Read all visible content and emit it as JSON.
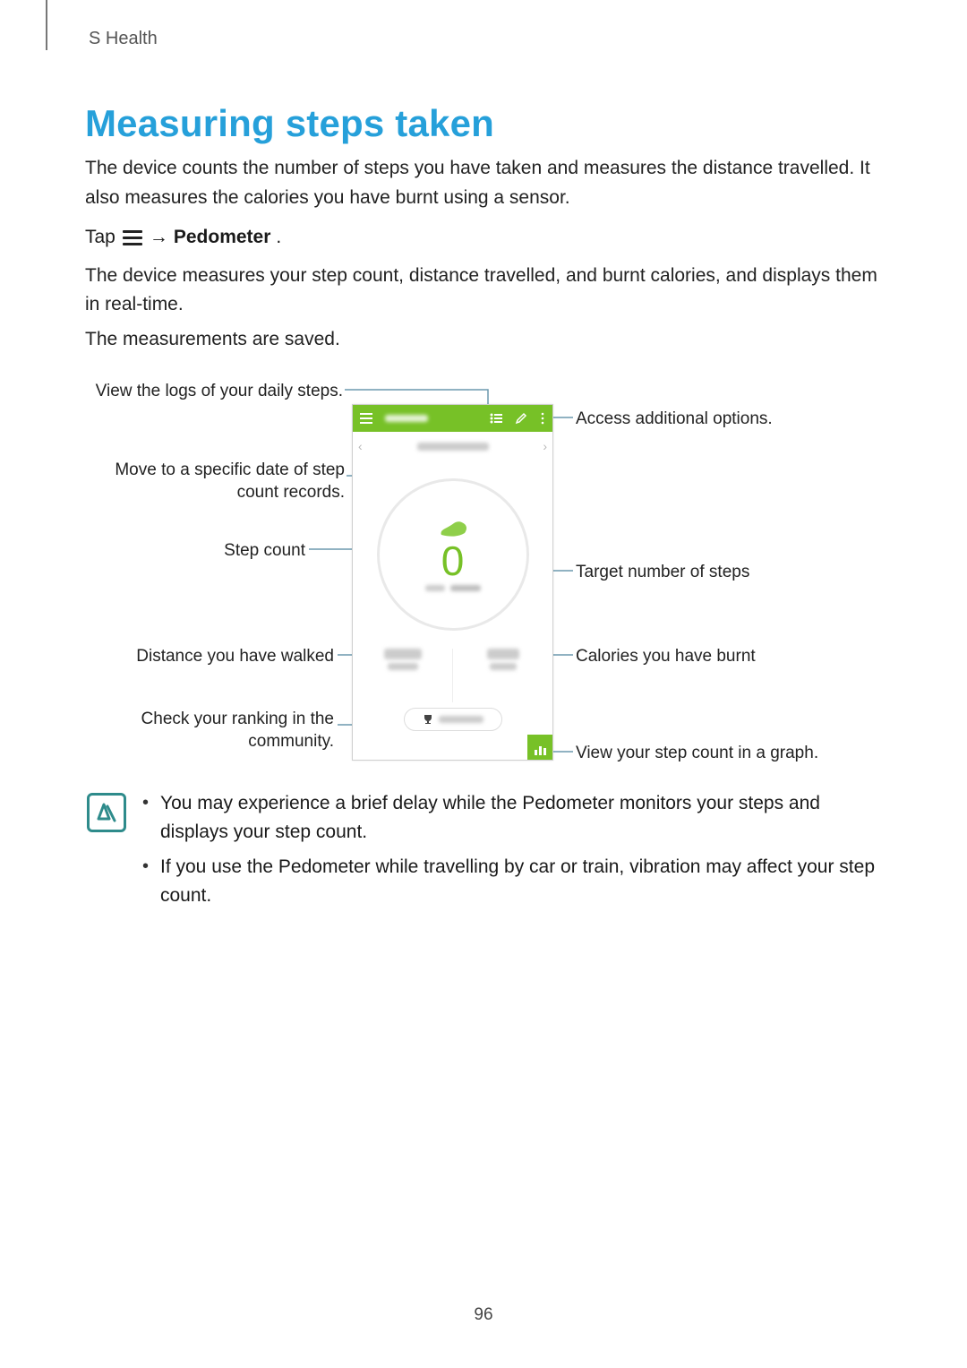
{
  "header": {
    "section": "S Health"
  },
  "title": "Measuring steps taken",
  "intro": "The device counts the number of steps you have taken and measures the distance travelled. It also measures the calories you have burnt using a sensor.",
  "tap_line": {
    "prefix": "Tap",
    "arrow": "→",
    "target": "Pedometer",
    "suffix": "."
  },
  "para2": "The device measures your step count, distance travelled, and burnt calories, and displays them in real-time.",
  "para3": "The measurements are saved.",
  "figure": {
    "step_count_value": "0",
    "callouts": {
      "logs": "View the logs of your daily steps.",
      "options": "Access additional options.",
      "date_nav_l1": "Move to a specific date of step",
      "date_nav_l2": "count records.",
      "step_count": "Step count",
      "target": "Target number of steps",
      "distance": "Distance you have walked",
      "calories": "Calories you have burnt",
      "ranking_l1": "Check your ranking in the",
      "ranking_l2": "community.",
      "graph": "View your step count in a graph."
    }
  },
  "notes": {
    "item1": "You may experience a brief delay while the Pedometer monitors your steps and displays your step count.",
    "item2": "If you use the Pedometer while travelling by car or train, vibration may affect your step count."
  },
  "page_number": "96"
}
